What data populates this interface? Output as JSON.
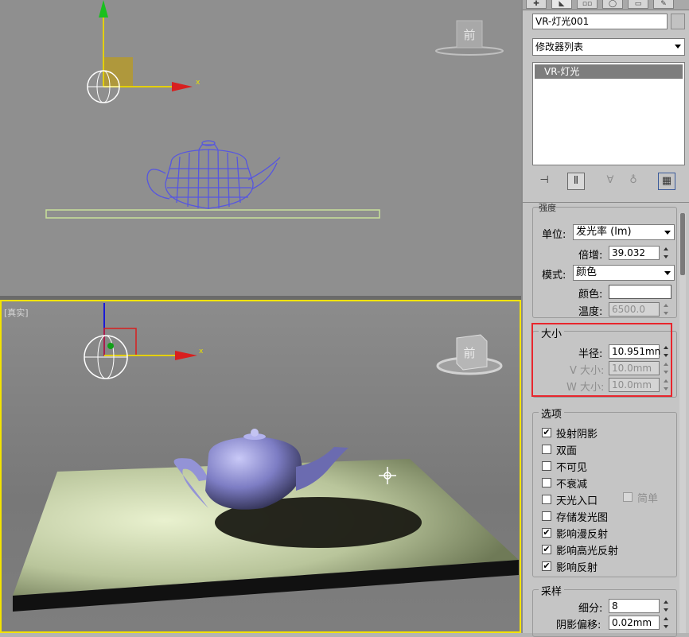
{
  "viewports": {
    "front": {
      "view_cube_label": "前",
      "axis_x": "x"
    },
    "perspective": {
      "label": "[真实]",
      "view_cube_label": "前",
      "axis_x": "x"
    }
  },
  "panel": {
    "object_name": "VR-灯光001",
    "modifier_list": "修改器列表",
    "modifier_stack": [
      "VR-灯光"
    ],
    "intensity": {
      "header": "强度",
      "units_label": "单位:",
      "units_value": "发光率 (lm)",
      "multiplier_label": "倍增:",
      "multiplier_value": "39.032",
      "mode_label": "模式:",
      "mode_value": "颜色",
      "color_label": "颜色:",
      "color_value": "#ffffff",
      "temperature_label": "温度:",
      "temperature_value": "6500.0"
    },
    "size": {
      "header": "大小",
      "radius_label": "半径:",
      "radius_value": "10.951mn",
      "v_label": "V 大小:",
      "v_value": "10.0mm",
      "w_label": "W 大小:",
      "w_value": "10.0mm"
    },
    "options": {
      "header": "选项",
      "items": [
        {
          "label": "投射阴影",
          "checked": true
        },
        {
          "label": "双面",
          "checked": false
        },
        {
          "label": "不可见",
          "checked": false
        },
        {
          "label": "不衰减",
          "checked": false
        },
        {
          "label": "天光入口",
          "checked": false
        },
        {
          "label": "存储发光图",
          "checked": false
        },
        {
          "label": "影响漫反射",
          "checked": true
        },
        {
          "label": "影响高光反射",
          "checked": true
        },
        {
          "label": "影响反射",
          "checked": true
        }
      ],
      "simple_label": "简单"
    },
    "sampling": {
      "header": "采样",
      "subdivs_label": "细分:",
      "subdivs_value": "8",
      "shadow_bias_label": "阴影偏移:",
      "shadow_bias_value": "0.02mm"
    }
  },
  "colors": {
    "active_viewport": "#f3e300",
    "highlight": "#e8262d",
    "wireframe": "#5656e0"
  }
}
